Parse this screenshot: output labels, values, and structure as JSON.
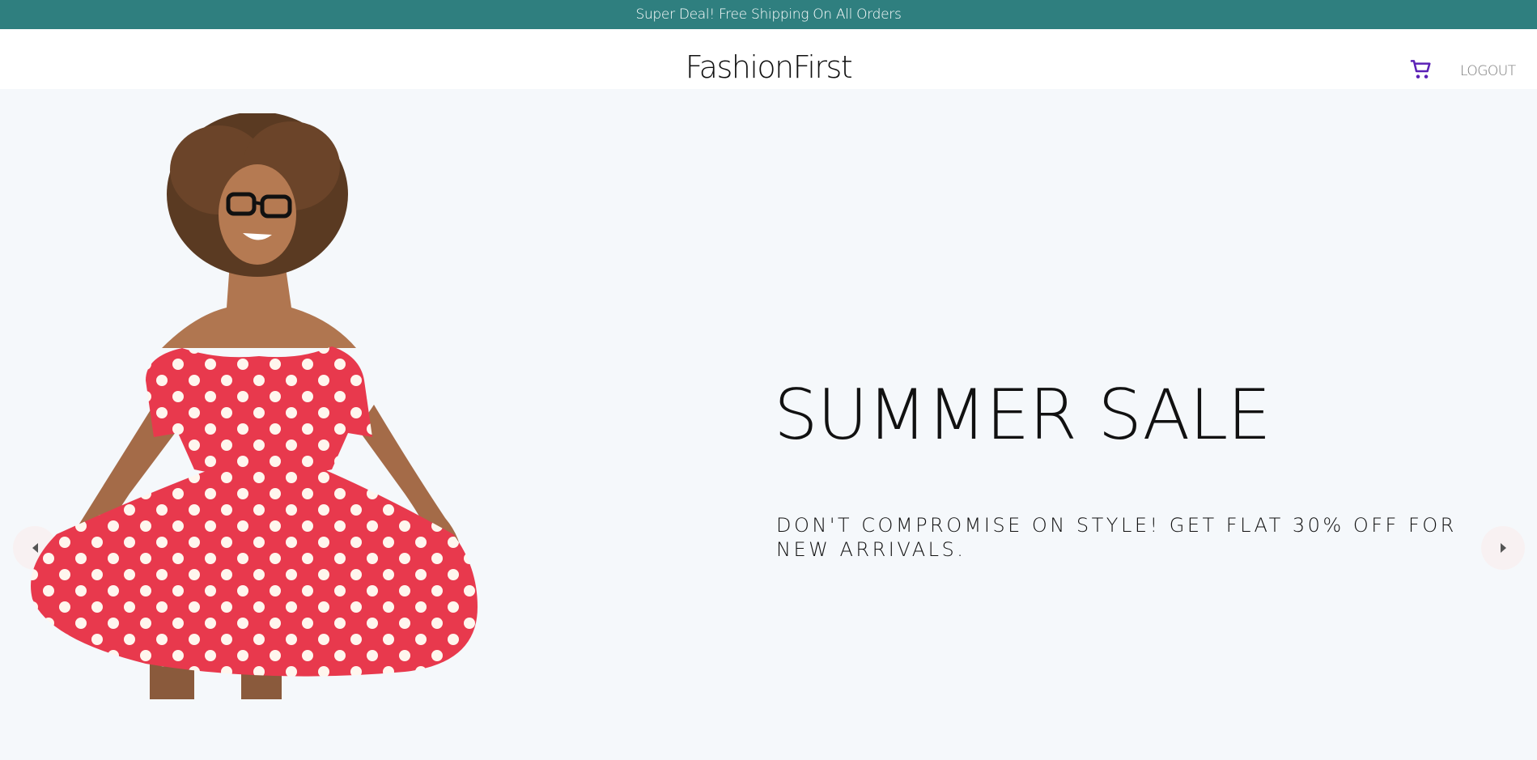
{
  "announcement": {
    "text": "Super Deal! Free Shipping On All Orders"
  },
  "navbar": {
    "logo": "FashionFirst",
    "cart_icon": "shopping-cart-icon",
    "logout_label": "LOGOUT"
  },
  "slider": {
    "slides": [
      {
        "title": "SUMMER SALE",
        "description": "DON'T COMPROMISE ON STYLE! GET FLAT 30% OFF FOR NEW ARRIVALS.",
        "image": "woman-in-red-polka-dot-dress"
      }
    ],
    "prev_icon": "arrow-left-icon",
    "next_icon": "arrow-right-icon"
  },
  "colors": {
    "announcement_bg": "#2f7f7f",
    "slider_bg": "#f5f8fb",
    "cart_icon": "#5b21b6",
    "dress_red": "#e8394d"
  }
}
